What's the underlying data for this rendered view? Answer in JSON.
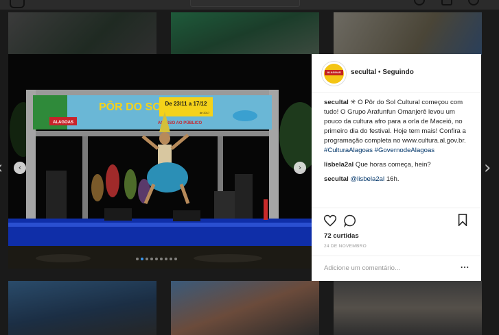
{
  "post": {
    "username": "secultal",
    "separator": "•",
    "follow_status": "Seguindo",
    "avatar_text": "ALAGOAS",
    "caption": {
      "user": "secultal",
      "text": "✳ O Pôr do Sol Cultural começou com tudo! O Grupo Arafunfun Omanjerê levou um pouco da cultura afro para a orla de Maceió, no primeiro dia do festival. Hoje tem mais! Confira a programação completa no www.cultura.al.gov.br. ",
      "hashtag1": "#CulturaAlagoas",
      "hashtag2": "#GovernodeAlagoas"
    },
    "comments": [
      {
        "user": "lisbela2al",
        "text": "Que horas começa, hein?"
      },
      {
        "user": "secultal",
        "mention": "@lisbela2al",
        "text": "16h."
      }
    ],
    "likes": "72 curtidas",
    "date": "24 DE NOVEMBRO",
    "add_comment_placeholder": "Adicione um comentário...",
    "more_options": "..."
  },
  "carousel": {
    "dots": 9,
    "active_dot": 1,
    "prev": "‹",
    "next": "›"
  },
  "stage_banner": {
    "brand_left": "ALAGOAS",
    "dates": "De 23/11 a 17/12",
    "year": "de 2017",
    "event": "PÔR DO SOL",
    "subtitle": "ACESSO AO PÚBLICO"
  },
  "colors": {
    "accent_blue": "#3897f0",
    "link": "#003569",
    "avatar_yellow": "#f4c514",
    "avatar_red": "#c5221f"
  }
}
